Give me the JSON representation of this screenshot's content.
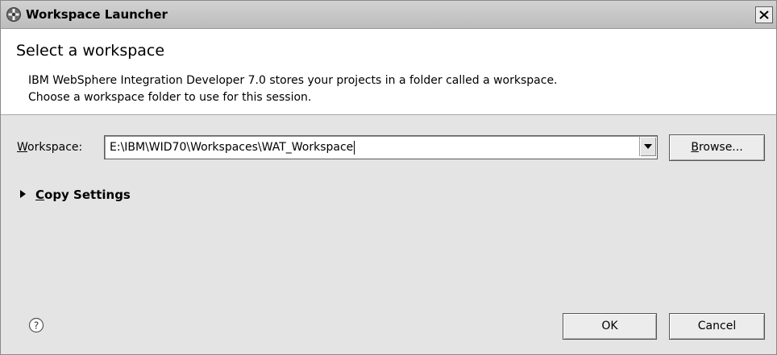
{
  "window": {
    "title": "Workspace Launcher",
    "icon": "workspace-launcher-icon",
    "close_icon": "close-icon"
  },
  "header": {
    "title": "Select a workspace",
    "description_line1": "IBM WebSphere Integration Developer 7.0 stores your projects in a folder called a workspace.",
    "description_line2": "Choose a workspace folder to use for this session."
  },
  "workspace": {
    "label_mnemonic": "W",
    "label_rest": "orkspace:",
    "value": "E:\\IBM\\WID70\\Workspaces\\WAT_Workspace",
    "dropdown_icon": "chevron-down-icon"
  },
  "browse": {
    "label_mnemonic": "B",
    "label_rest": "rowse..."
  },
  "copy_settings": {
    "label_mnemonic": "C",
    "label_rest": "opy Settings",
    "expanded": false,
    "icon": "triangle-right-icon"
  },
  "footer": {
    "help_icon": "help-icon",
    "ok_label": "OK",
    "cancel_label": "Cancel"
  },
  "colors": {
    "window_bg": "#e4e4e4",
    "header_bg": "#ffffff",
    "titlebar_bg": "#c8c8c8"
  }
}
